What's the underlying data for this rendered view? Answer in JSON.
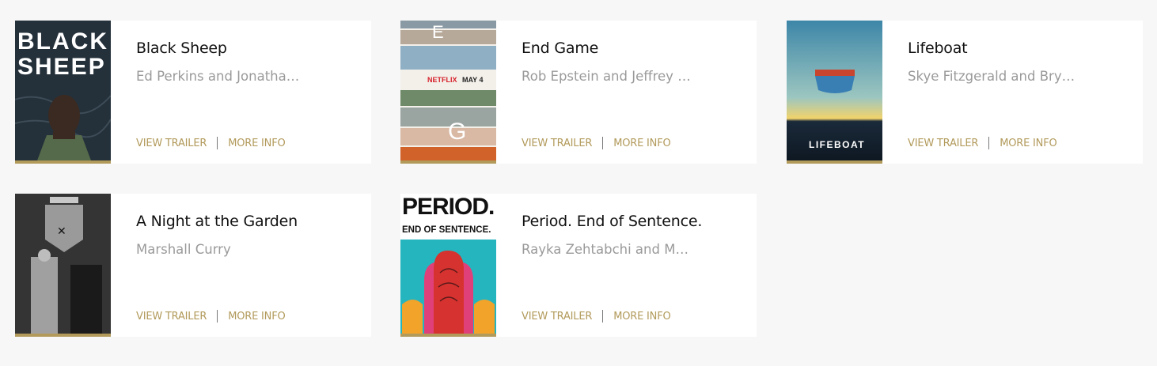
{
  "films": [
    {
      "title": "Black Sheep",
      "credit": "Ed Perkins and Jonathan Chinn",
      "view_trailer": "VIEW TRAILER",
      "more_info": "MORE INFO",
      "poster_text": [
        "BLACK",
        "SHEEP"
      ]
    },
    {
      "title": "End Game",
      "credit": "Rob Epstein and Jeffrey Friedman",
      "view_trailer": "VIEW TRAILER",
      "more_info": "MORE INFO",
      "poster_text": [
        "NETFLIX",
        "MAY 4"
      ]
    },
    {
      "title": "Lifeboat",
      "credit": "Skye Fitzgerald and Bryn Mooser",
      "view_trailer": "VIEW TRAILER",
      "more_info": "MORE INFO",
      "poster_text": [
        "LIFEBOAT"
      ]
    },
    {
      "title": "A Night at the Garden",
      "credit": "Marshall Curry",
      "view_trailer": "VIEW TRAILER",
      "more_info": "MORE INFO",
      "poster_text": []
    },
    {
      "title": "Period. End of Sentence.",
      "credit": "Rayka Zehtabchi and Melissa Berton",
      "view_trailer": "VIEW TRAILER",
      "more_info": "MORE INFO",
      "poster_text": [
        "PERIOD.",
        "END OF SENTENCE."
      ]
    }
  ],
  "colors": {
    "accent_gold": "#b29a5b",
    "page_bg": "#f7f7f7",
    "card_bg": "#ffffff",
    "credit_gray": "#9a9a9a"
  }
}
